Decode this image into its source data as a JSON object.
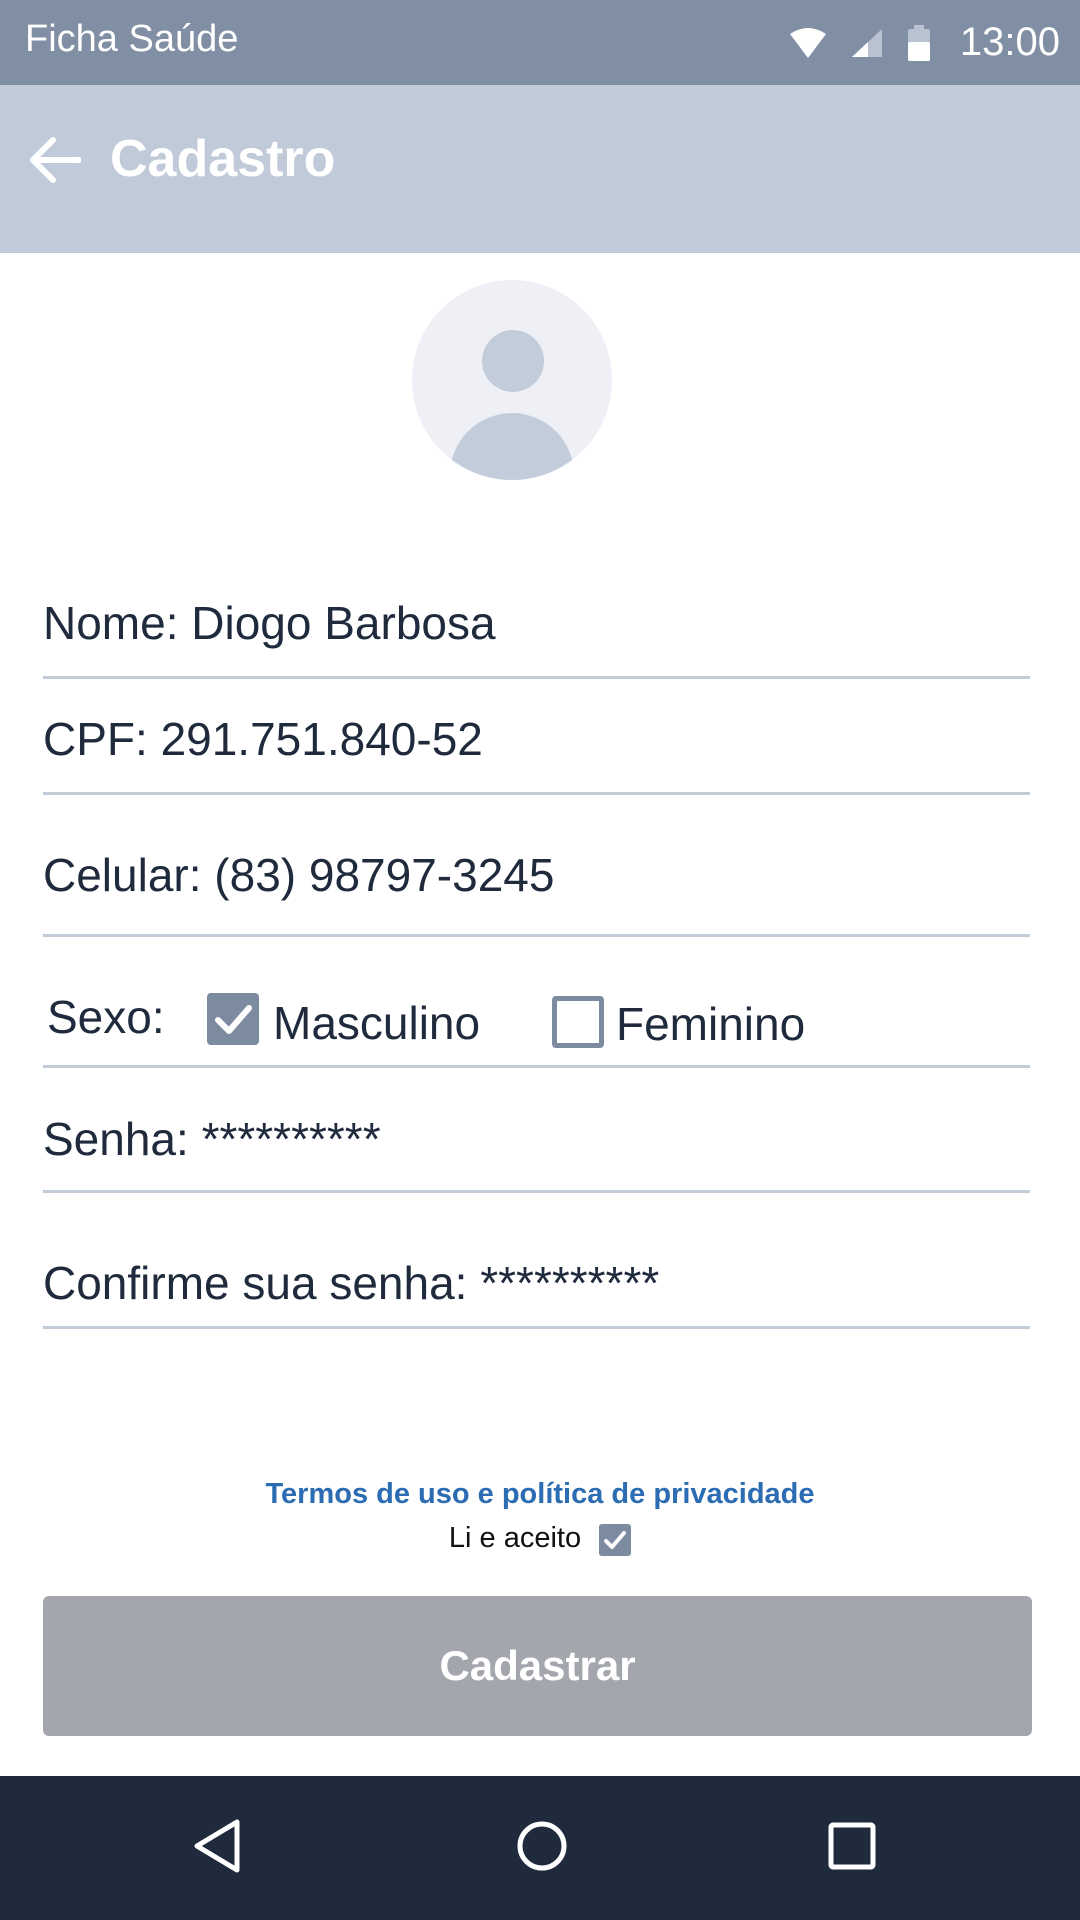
{
  "status_bar": {
    "app_name": "Ficha Saúde",
    "time": "13:00"
  },
  "app_bar": {
    "title": "Cadastro"
  },
  "form": {
    "nome": {
      "label": "Nome: ",
      "value": "Diogo Barbosa"
    },
    "cpf": {
      "label": "CPF: ",
      "value": "291.751.840-52"
    },
    "celular": {
      "label": "Celular: ",
      "value": "(83) 98797-3245"
    },
    "sexo": {
      "label": "Sexo:",
      "options": [
        {
          "label": "Masculino",
          "checked": true
        },
        {
          "label": "Feminino",
          "checked": false
        }
      ]
    },
    "senha": {
      "label": "Senha: ",
      "value": "**********"
    },
    "confirme_senha": {
      "label": "Confirme sua senha: ",
      "value": "**********"
    }
  },
  "terms": {
    "link_text": "Termos de uso e política de privacidade",
    "accept_text": "Li e aceito",
    "accepted": true
  },
  "submit": {
    "label": "Cadastrar"
  },
  "colors": {
    "status_bar": "#818fa4",
    "app_bar": "#c0cad8",
    "link": "#2b6cb3",
    "checkbox": "#7d8ba0",
    "button_disabled": "#a3a7ad",
    "nav_bar": "#1f2a3c"
  }
}
